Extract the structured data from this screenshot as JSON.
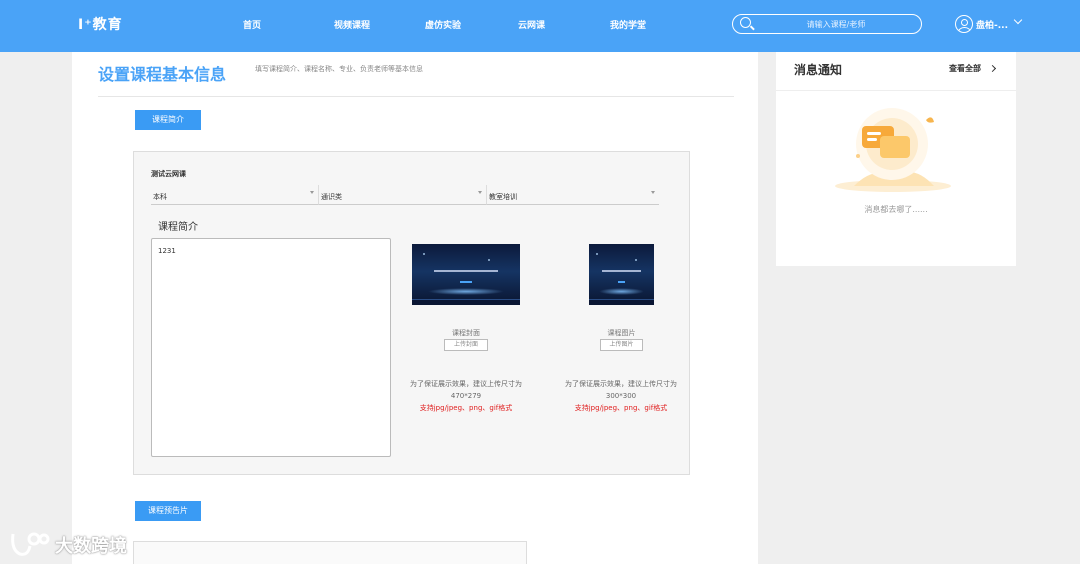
{
  "header": {
    "logo": "I⁺教育",
    "nav": [
      "首页",
      "视频课程",
      "虚仿实验",
      "云网课",
      "我的学堂"
    ],
    "search_placeholder": "请输入课程/老师",
    "user_name": "盘柏-..."
  },
  "main": {
    "title": "设置课程基本信息",
    "subtitle": "填写课程简介、课程名称、专业、负责老师等基本信息",
    "intro_button": "课程简介",
    "course_name": "测试云网课",
    "selects": [
      "本科",
      "通识类",
      "教室培训"
    ],
    "intro_label": "课程简介",
    "intro_value": "1231",
    "cover": {
      "label": "课程封面",
      "upload": "上传封面",
      "hint": "为了保证展示效果，建议上传尺寸为470*279",
      "formats": "支持jpg/jpeg、png、gif格式"
    },
    "picture": {
      "label": "课程图片",
      "upload": "上传图片",
      "hint": "为了保证展示效果，建议上传尺寸为300*300",
      "formats": "支持jpg/jpeg、png、gif格式"
    },
    "trailer_button": "课程预告片"
  },
  "side": {
    "title": "消息通知",
    "view_all": "查看全部",
    "empty_text": "消息都去哪了......"
  },
  "watermark": {
    "text": "大数跨境"
  },
  "colors": {
    "brand": "#4aa3f7",
    "button": "#3a9bf4",
    "warn": "#e02020"
  }
}
